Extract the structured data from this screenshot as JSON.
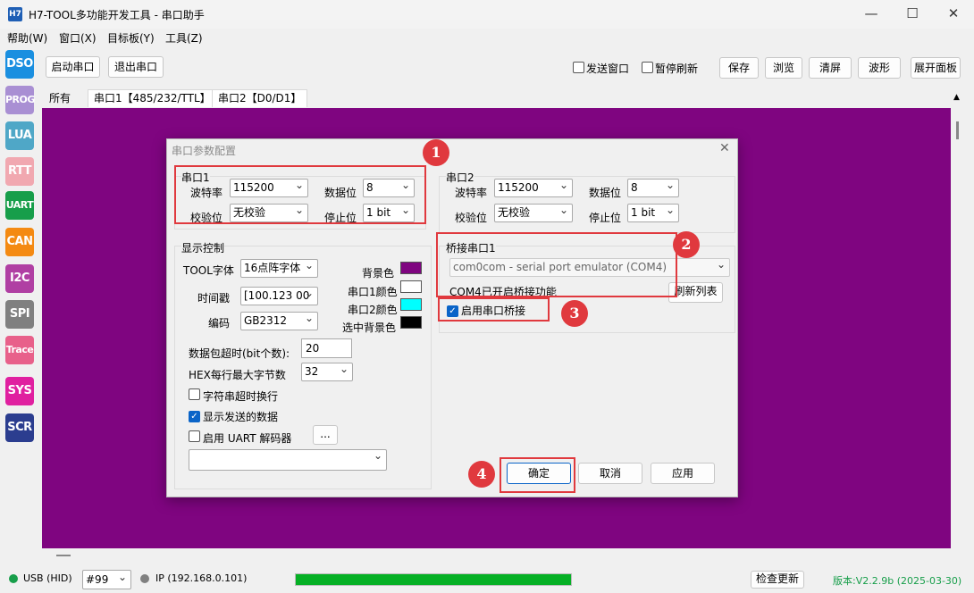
{
  "window": {
    "icon_label": "H7",
    "title": "H7-TOOL多功能开发工具 - 串口助手",
    "minimize": "—",
    "maximize": "☐",
    "close": "✕"
  },
  "menu": [
    "帮助(W)",
    "窗口(X)",
    "目标板(Y)",
    "工具(Z)"
  ],
  "sidebar": [
    {
      "label": "DSO",
      "color": "#1a8fe0"
    },
    {
      "label": "PROG",
      "color": "#a98fd3"
    },
    {
      "label": "LUA",
      "color": "#4fa7c7"
    },
    {
      "label": "RTT",
      "color": "#f1a8b0"
    },
    {
      "label": "UART",
      "color": "#179e4a"
    },
    {
      "label": "CAN",
      "color": "#f48a12"
    },
    {
      "label": "I2C",
      "color": "#b03fa3"
    },
    {
      "label": "SPI",
      "color": "#808080"
    },
    {
      "label": "Trace",
      "color": "#e8608a"
    },
    {
      "label": "SYS",
      "color": "#e020a0"
    },
    {
      "label": "SCR",
      "color": "#2b3d8f"
    }
  ],
  "toolbar": {
    "start": "启动串口",
    "exit": "退出串口",
    "send_window": "发送窗口",
    "pause_refresh": "暂停刷新",
    "save": "保存",
    "browse": "浏览",
    "clear": "清屏",
    "wave": "波形",
    "expand": "展开面板"
  },
  "tabs": [
    "所有",
    "串口1【485/232/TTL】",
    "串口2【D0/D1】"
  ],
  "dialog": {
    "title": "串口参数配置",
    "close": "✕",
    "port1": {
      "title": "串口1",
      "baud_label": "波特率",
      "baud": "115200",
      "data_label": "数据位",
      "data": "8",
      "parity_label": "校验位",
      "parity": "无校验",
      "stop_label": "停止位",
      "stop": "1 bit"
    },
    "port2": {
      "title": "串口2",
      "baud_label": "波特率",
      "baud": "115200",
      "data_label": "数据位",
      "data": "8",
      "parity_label": "校验位",
      "parity": "无校验",
      "stop_label": "停止位",
      "stop": "1 bit"
    },
    "display": {
      "title": "显示控制",
      "font_label": "TOOL字体",
      "font": "16点阵字体",
      "timestamp_label": "时间戳",
      "timestamp": "[100.123 00",
      "encoding_label": "编码",
      "encoding": "GB2312",
      "bg_label": "背景色",
      "bg_color": "#7f0580",
      "port1_label": "串口1颜色",
      "port1_color": "#ffffff",
      "port2_label": "串口2颜色",
      "port2_color": "#00ffff",
      "sel_bg_label": "选中背景色",
      "sel_bg_color": "#000000",
      "timeout_label": "数据包超时(bit个数):",
      "timeout": "20",
      "hex_label": "HEX每行最大字节数",
      "hex": "32",
      "wrap_label": "字符串超时换行",
      "show_sent_label": "显示发送的数据",
      "uart_decoder_label": "启用  UART 解码器",
      "more": "..."
    },
    "bridge": {
      "title": "桥接串口1",
      "port": "com0com - serial port emulator (COM4)",
      "status": "COM4已开启桥接功能",
      "refresh": "刷新列表",
      "enable_label": "启用串口桥接"
    },
    "ok": "确定",
    "cancel": "取消",
    "apply": "应用",
    "badges": [
      "1",
      "2",
      "3",
      "4"
    ]
  },
  "status": {
    "usb": "USB (HID)",
    "channel": "#99",
    "ip": "IP (192.168.0.101)",
    "progress": 100,
    "check_update": "检查更新",
    "version": "版本:V2.2.9b (2025-03-30)"
  }
}
